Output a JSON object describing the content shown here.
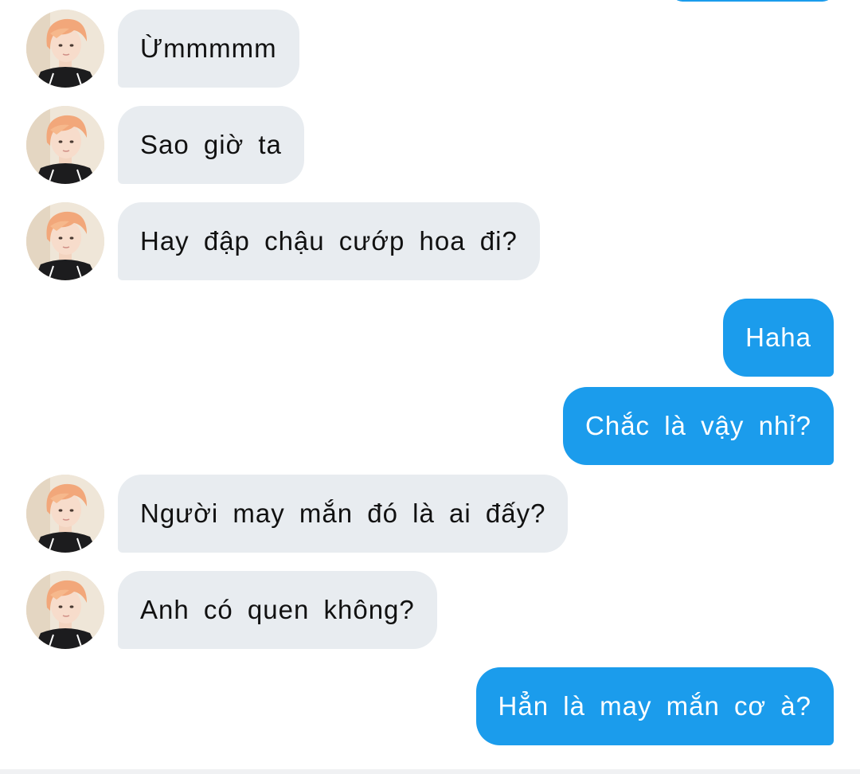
{
  "colors": {
    "outgoing_bubble": "#1b9cec",
    "incoming_bubble": "#e8ecf0",
    "outgoing_text": "#ffffff",
    "incoming_text": "#111111"
  },
  "contact": {
    "avatar_icon": "profile-photo-orange-hair"
  },
  "messages": [
    {
      "direction": "incoming",
      "text": "Ừmmmmm"
    },
    {
      "direction": "incoming",
      "text": "Sao giờ ta"
    },
    {
      "direction": "incoming",
      "text": "Hay đập chậu cướp hoa đi?"
    },
    {
      "direction": "outgoing",
      "text": "Haha"
    },
    {
      "direction": "outgoing",
      "text": "Chắc là vậy nhỉ?"
    },
    {
      "direction": "incoming",
      "text": "Người may mắn đó là ai đấy?"
    },
    {
      "direction": "incoming",
      "text": "Anh có quen không?"
    },
    {
      "direction": "outgoing",
      "text": "Hẳn là may mắn cơ à?"
    }
  ]
}
